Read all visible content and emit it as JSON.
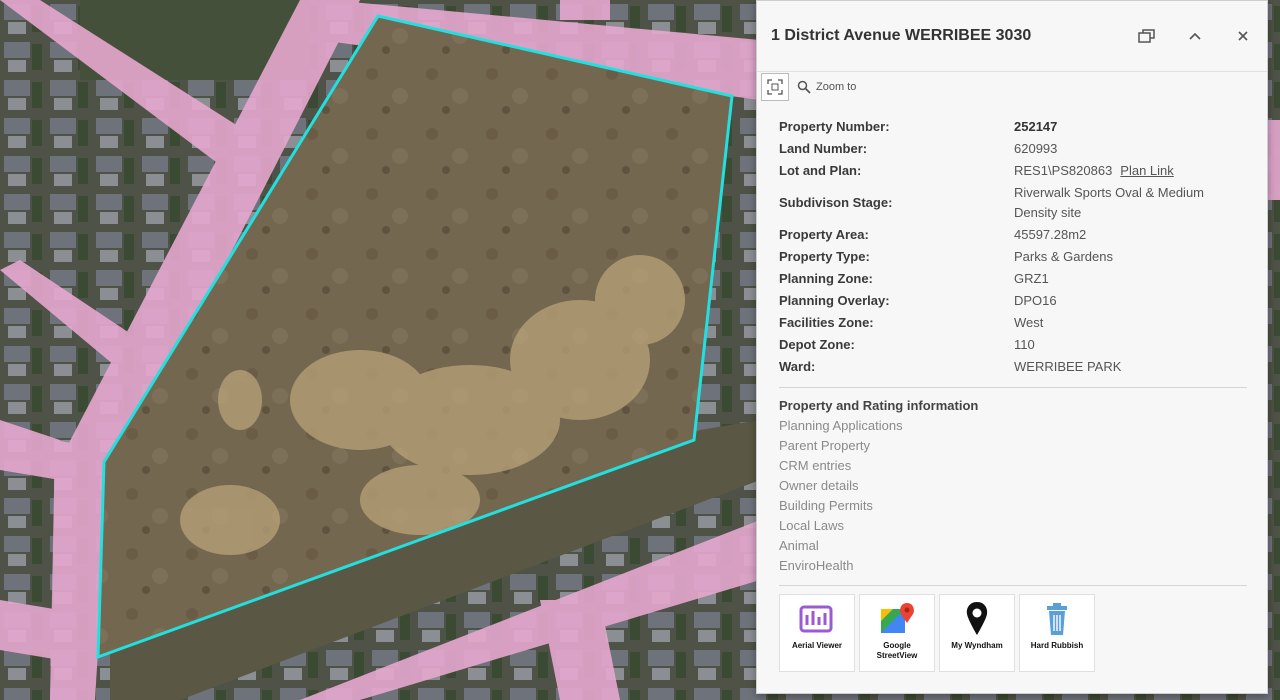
{
  "popup": {
    "title": "1 District Avenue WERRIBEE 3030",
    "zoom_label": "Zoom to",
    "attributes": [
      {
        "key": "Property Number:",
        "value": "252147"
      },
      {
        "key": "Land Number:",
        "value": "620993"
      },
      {
        "key": "Lot and Plan:",
        "value": "RES1\\PS820863",
        "link": "Plan Link"
      },
      {
        "key": "Subdivison Stage:",
        "value": "Riverwalk Sports Oval & Medium Density site"
      },
      {
        "key": "Property Area:",
        "value": "45597.28m2"
      },
      {
        "key": "Property Type:",
        "value": "Parks & Gardens"
      },
      {
        "key": "Planning Zone:",
        "value": "GRZ1"
      },
      {
        "key": "Planning Overlay:",
        "value": "DPO16"
      },
      {
        "key": "Facilities Zone:",
        "value": "West"
      },
      {
        "key": "Depot Zone:",
        "value": "110"
      },
      {
        "key": "Ward:",
        "value": "WERRIBEE PARK"
      }
    ],
    "rating_heading": "Property and Rating information",
    "links": [
      "Planning Applications",
      "Parent Property",
      "CRM entries",
      "Owner details",
      "Building Permits",
      "Local Laws",
      "Animal",
      "EnviroHealth"
    ],
    "launchers": [
      {
        "label": "Aerial Viewer",
        "icon": "aerial-viewer-icon"
      },
      {
        "label": "Google StreetView",
        "icon": "google-maps-icon"
      },
      {
        "label": "My Wyndham",
        "icon": "location-pin-icon"
      },
      {
        "label": "Hard Rubbish",
        "icon": "rubbish-bin-icon"
      }
    ]
  },
  "colors": {
    "parcel_outline": "#22e0e0",
    "road_overlay": "#e6a8cf",
    "land": "#7a6a50"
  }
}
